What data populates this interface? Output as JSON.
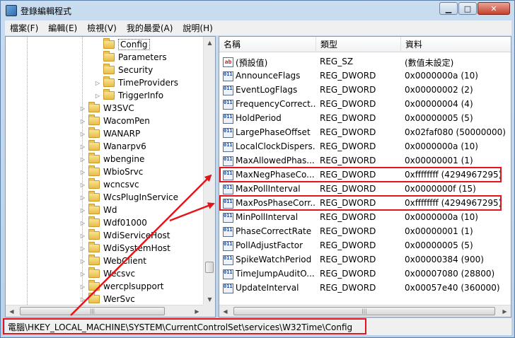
{
  "window": {
    "title": "登錄編輯程式"
  },
  "menu": [
    "檔案(F)",
    "編輯(E)",
    "檢視(V)",
    "我的最愛(A)",
    "說明(H)"
  ],
  "tree": [
    {
      "label": "Config",
      "level": 2
    },
    {
      "label": "Parameters",
      "level": 2
    },
    {
      "label": "Security",
      "level": 2
    },
    {
      "label": "TimeProviders",
      "level": 2
    },
    {
      "label": "TriggerInfo",
      "level": 2
    },
    {
      "label": "W3SVC",
      "level": 1
    },
    {
      "label": "WacomPen",
      "level": 1
    },
    {
      "label": "WANARP",
      "level": 1
    },
    {
      "label": "Wanarpv6",
      "level": 1
    },
    {
      "label": "wbengine",
      "level": 1
    },
    {
      "label": "WbioSrvc",
      "level": 1
    },
    {
      "label": "wcncsvc",
      "level": 1
    },
    {
      "label": "WcsPlugInService",
      "level": 1
    },
    {
      "label": "Wd",
      "level": 1
    },
    {
      "label": "Wdf01000",
      "level": 1
    },
    {
      "label": "WdiServiceHost",
      "level": 1
    },
    {
      "label": "WdiSystemHost",
      "level": 1
    },
    {
      "label": "WebClient",
      "level": 1
    },
    {
      "label": "Wecsvc",
      "level": 1
    },
    {
      "label": "wercplsupport",
      "level": 1
    },
    {
      "label": "WerSvc",
      "level": 1
    }
  ],
  "columns": {
    "name": "名稱",
    "type": "類型",
    "data": "資料"
  },
  "values": [
    {
      "name": "(預設值)",
      "type": "REG_SZ",
      "data": "(數值未設定)",
      "icon": "string-value-icon"
    },
    {
      "name": "AnnounceFlags",
      "type": "REG_DWORD",
      "data": "0x0000000a (10)",
      "icon": "dword-value-icon"
    },
    {
      "name": "EventLogFlags",
      "type": "REG_DWORD",
      "data": "0x00000002 (2)",
      "icon": "dword-value-icon"
    },
    {
      "name": "FrequencyCorrect...",
      "type": "REG_DWORD",
      "data": "0x00000004 (4)",
      "icon": "dword-value-icon"
    },
    {
      "name": "HoldPeriod",
      "type": "REG_DWORD",
      "data": "0x00000005 (5)",
      "icon": "dword-value-icon"
    },
    {
      "name": "LargePhaseOffset",
      "type": "REG_DWORD",
      "data": "0x02faf080 (50000000)",
      "icon": "dword-value-icon"
    },
    {
      "name": "LocalClockDispers...",
      "type": "REG_DWORD",
      "data": "0x0000000a (10)",
      "icon": "dword-value-icon"
    },
    {
      "name": "MaxAllowedPhas...",
      "type": "REG_DWORD",
      "data": "0x00000001 (1)",
      "icon": "dword-value-icon"
    },
    {
      "name": "MaxNegPhaseCo...",
      "type": "REG_DWORD",
      "data": "0xffffffff (4294967295)",
      "icon": "dword-value-icon"
    },
    {
      "name": "MaxPollInterval",
      "type": "REG_DWORD",
      "data": "0x0000000f (15)",
      "icon": "dword-value-icon"
    },
    {
      "name": "MaxPosPhaseCorr...",
      "type": "REG_DWORD",
      "data": "0xffffffff (4294967295)",
      "icon": "dword-value-icon"
    },
    {
      "name": "MinPollInterval",
      "type": "REG_DWORD",
      "data": "0x0000000a (10)",
      "icon": "dword-value-icon"
    },
    {
      "name": "PhaseCorrectRate",
      "type": "REG_DWORD",
      "data": "0x00000001 (1)",
      "icon": "dword-value-icon"
    },
    {
      "name": "PollAdjustFactor",
      "type": "REG_DWORD",
      "data": "0x00000005 (5)",
      "icon": "dword-value-icon"
    },
    {
      "name": "SpikeWatchPeriod",
      "type": "REG_DWORD",
      "data": "0x00000384 (900)",
      "icon": "dword-value-icon"
    },
    {
      "name": "TimeJumpAuditO...",
      "type": "REG_DWORD",
      "data": "0x00007080 (28800)",
      "icon": "dword-value-icon"
    },
    {
      "name": "UpdateInterval",
      "type": "REG_DWORD",
      "data": "0x00057e40 (360000)",
      "icon": "dword-value-icon"
    }
  ],
  "status": {
    "path": "電腦\\HKEY_LOCAL_MACHINE\\SYSTEM\\CurrentControlSet\\services\\W32Time\\Config"
  },
  "colors": {
    "highlight": "#e3151c",
    "chrome": "#c9dcf0"
  }
}
